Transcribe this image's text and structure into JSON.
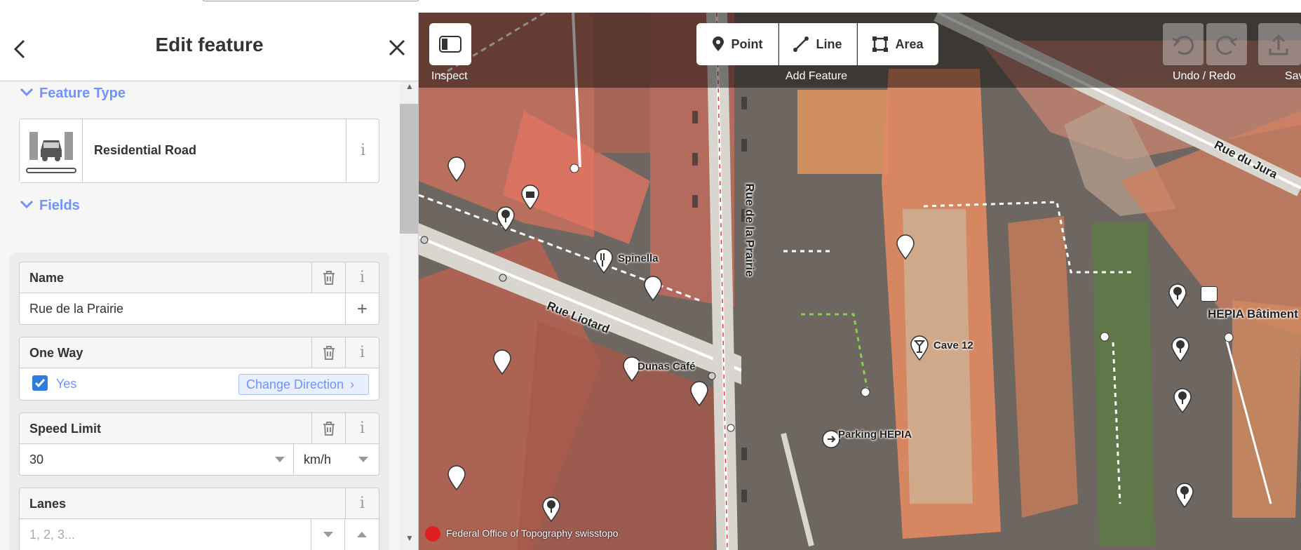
{
  "sidebar": {
    "title": "Edit feature",
    "feature_type_header": "Feature Type",
    "fields_header": "Fields",
    "preset": {
      "name": "Residential Road",
      "icon": "residential-road-icon"
    },
    "fields": {
      "name": {
        "label": "Name",
        "value": "Rue de la Prairie"
      },
      "oneway": {
        "label": "One Way",
        "checkbox_label": "Yes",
        "checked": true,
        "change_direction": "Change Direction"
      },
      "speed": {
        "label": "Speed Limit",
        "value": "30",
        "unit": "km/h"
      },
      "lanes": {
        "label": "Lanes",
        "placeholder": "1, 2, 3..."
      }
    }
  },
  "toolbar": {
    "inspect_label": "Inspect",
    "point_label": "Point",
    "line_label": "Line",
    "area_label": "Area",
    "add_feature_label": "Add Feature",
    "undo_redo_label": "Undo / Redo",
    "save_label": "Save"
  },
  "map": {
    "street_labels": {
      "rue_de_la_prairie": "Rue de la Prairie",
      "rue_liotard": "Rue Liotard",
      "rue_du_jura": "Rue du Jura"
    },
    "pois": {
      "spinella": "Spinella",
      "dunas_cafe": "Dunas Café",
      "cave_12": "Cave 12",
      "parking_hepia": "Parking HEPIA",
      "hepia_batiment": "HEPIA Bâtiment"
    },
    "attribution": "Federal Office of Topography swisstopo"
  },
  "colors": {
    "accent": "#7092ff",
    "building_overlay": "#e5735f",
    "checkbox": "#2f7ddb"
  }
}
